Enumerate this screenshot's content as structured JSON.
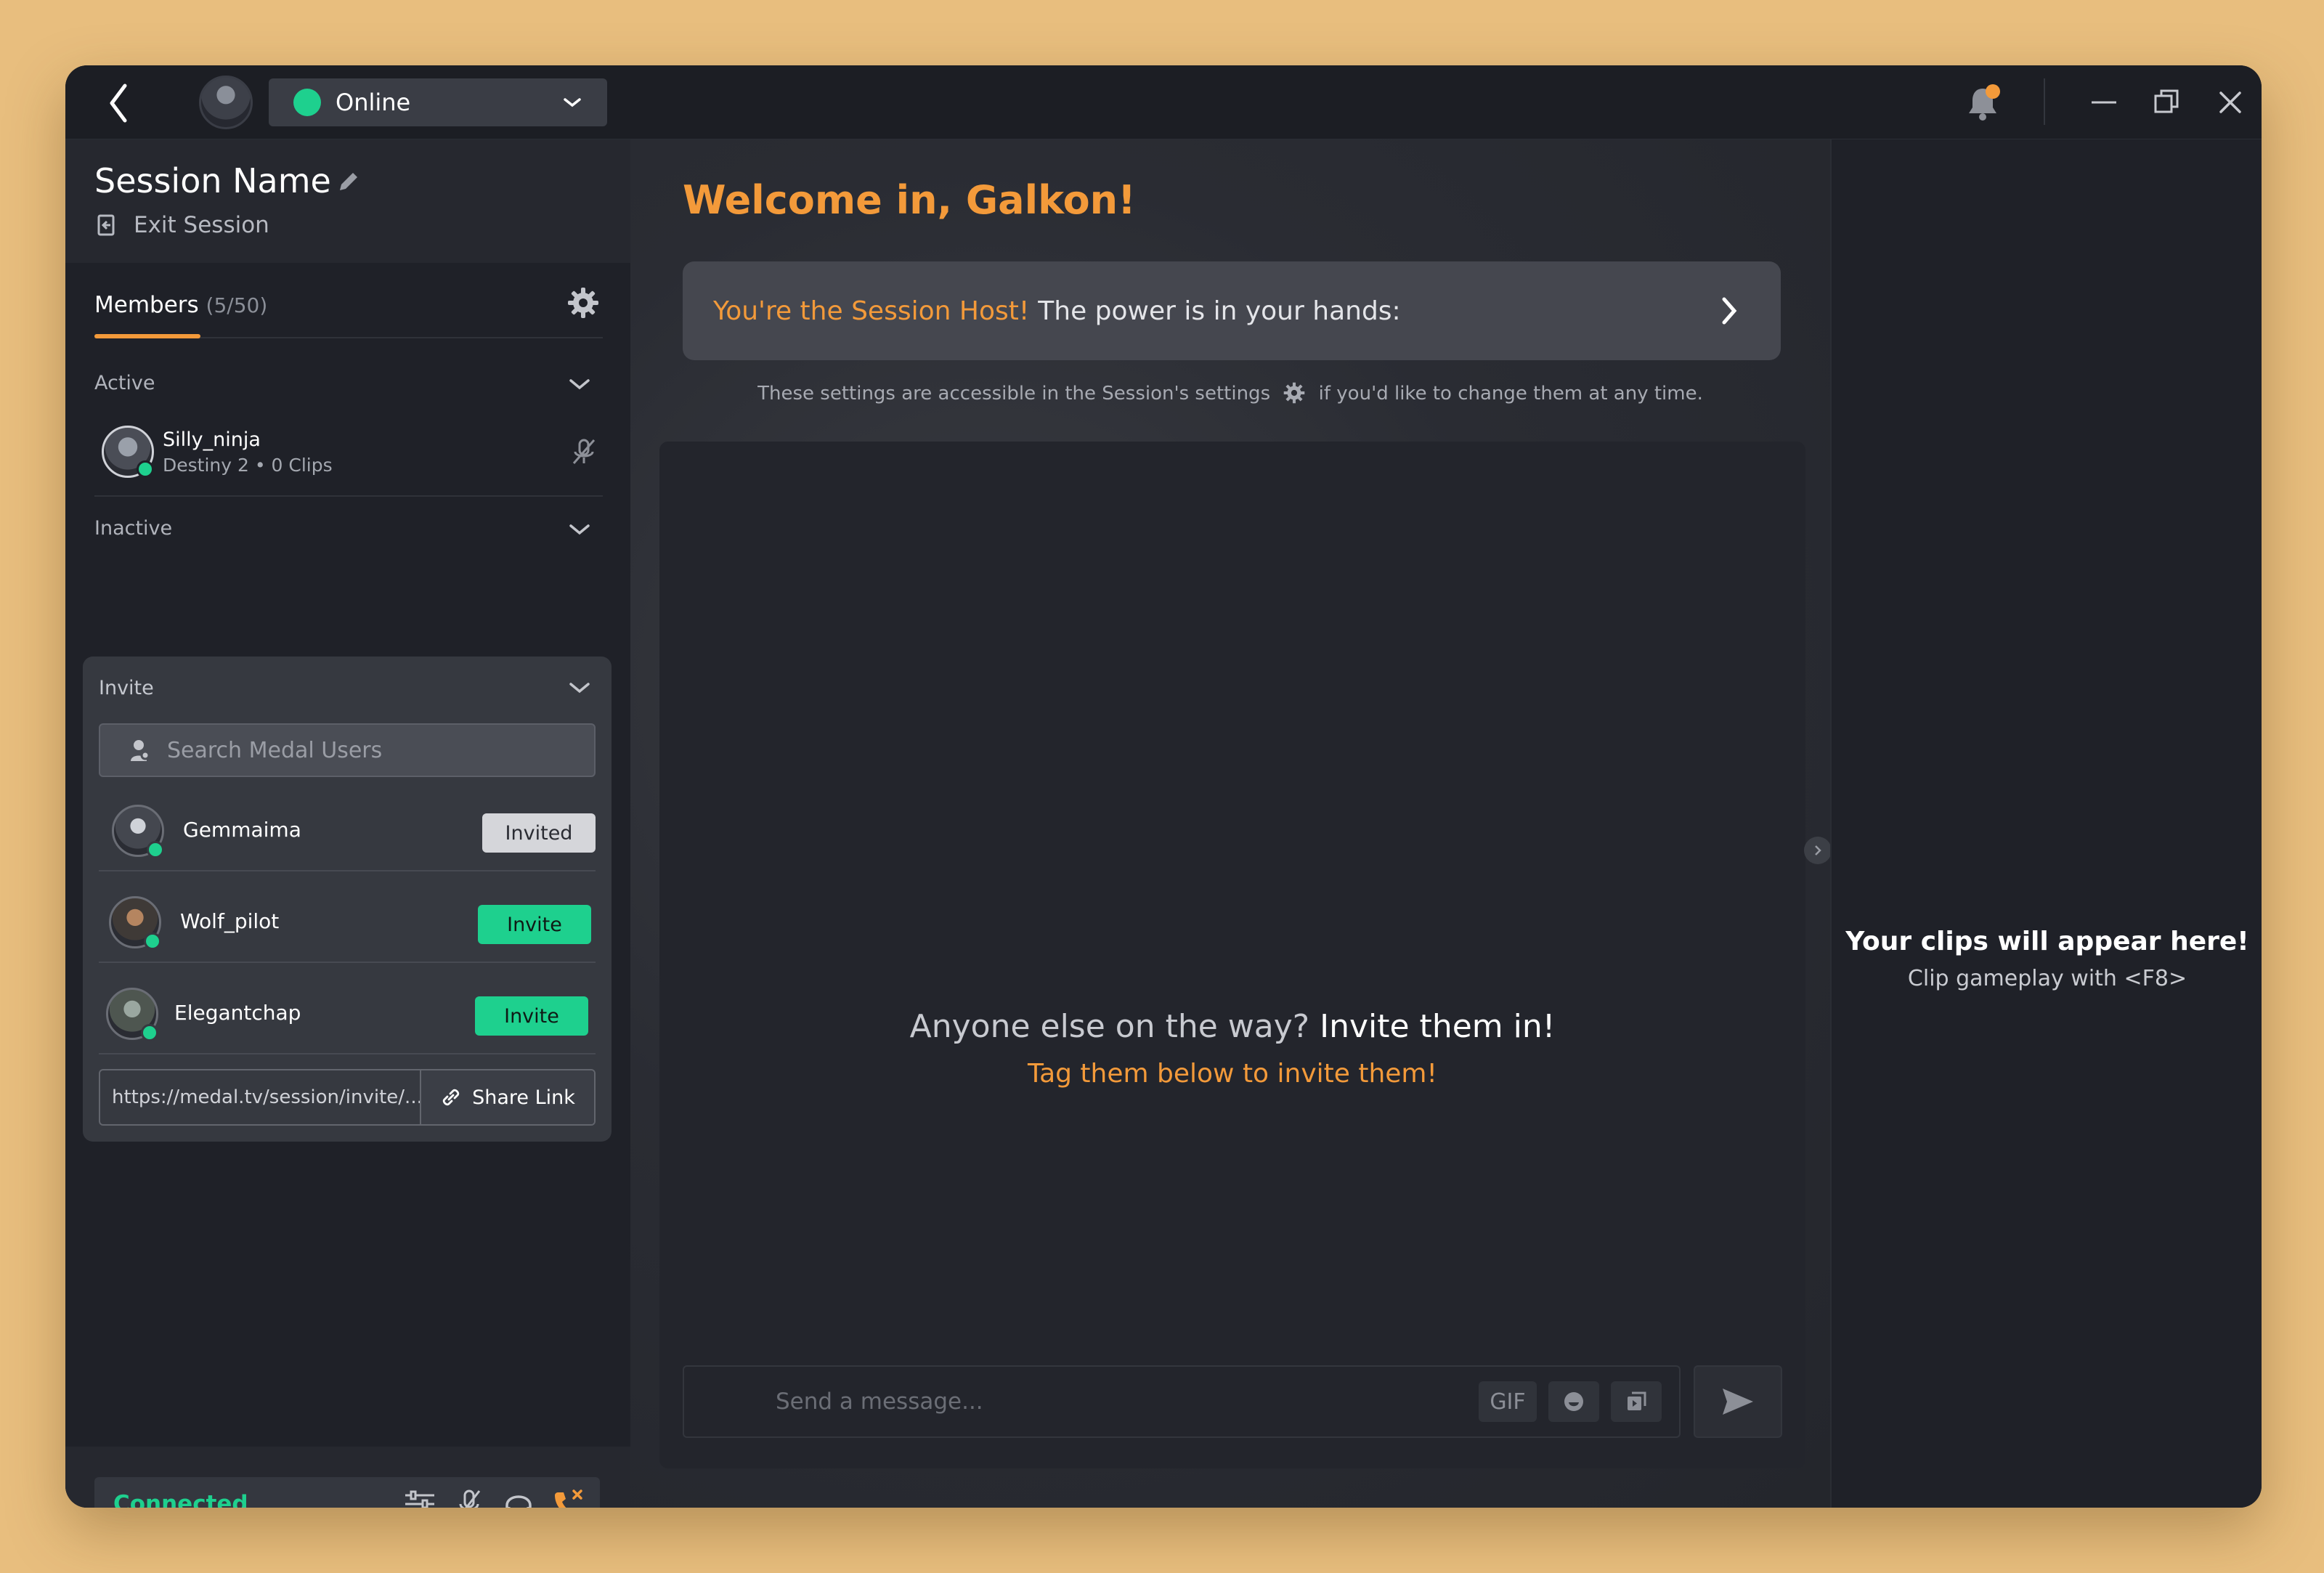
{
  "titlebar": {
    "status_label": "Online",
    "status_color": "#1ED08E",
    "icons": [
      "back-icon",
      "chevron-down-icon",
      "bell-icon",
      "minimize-icon",
      "restore-icon",
      "close-icon"
    ]
  },
  "session": {
    "name": "Session Name",
    "exit_label": "Exit Session"
  },
  "members": {
    "tab_label": "Members",
    "count": "(5/50)",
    "active_label": "Active",
    "inactive_label": "Inactive",
    "active_members": [
      {
        "name": "Silly_ninja",
        "sub": "Destiny 2 • 0 Clips"
      }
    ]
  },
  "invite": {
    "label": "Invite",
    "search_placeholder": "Search Medal Users",
    "users": [
      {
        "name": "Gemmaima",
        "button": "Invited"
      },
      {
        "name": "Wolf_pilot",
        "button": "Invite"
      },
      {
        "name": "Elegantchap",
        "button": "Invite"
      }
    ],
    "share_url": "https://medal.tv/session/invite/...",
    "share_label": "Share Link"
  },
  "bottom": {
    "connected_label": "Connected"
  },
  "center": {
    "welcome": "Welcome in, Galkon!",
    "host_highlight": "You're the Session Host!",
    "host_rest": "The power is in your hands:",
    "settings_note_before": "These settings are accessible in the Session's settings",
    "settings_note_after": "if you'd like to change them at any time.",
    "empty_title_a": "Anyone else on the way?",
    "empty_title_b": "Invite them in!",
    "empty_sub": "Tag them below to invite them!",
    "message_placeholder": "Send a message...",
    "gif_label": "GIF"
  },
  "right": {
    "clips_title": "Your clips will appear here!",
    "clips_sub": "Clip gameplay with <F8>"
  },
  "colors": {
    "accent": "#F39A3A",
    "green": "#1ED08E",
    "background": "#E8BE7E"
  }
}
